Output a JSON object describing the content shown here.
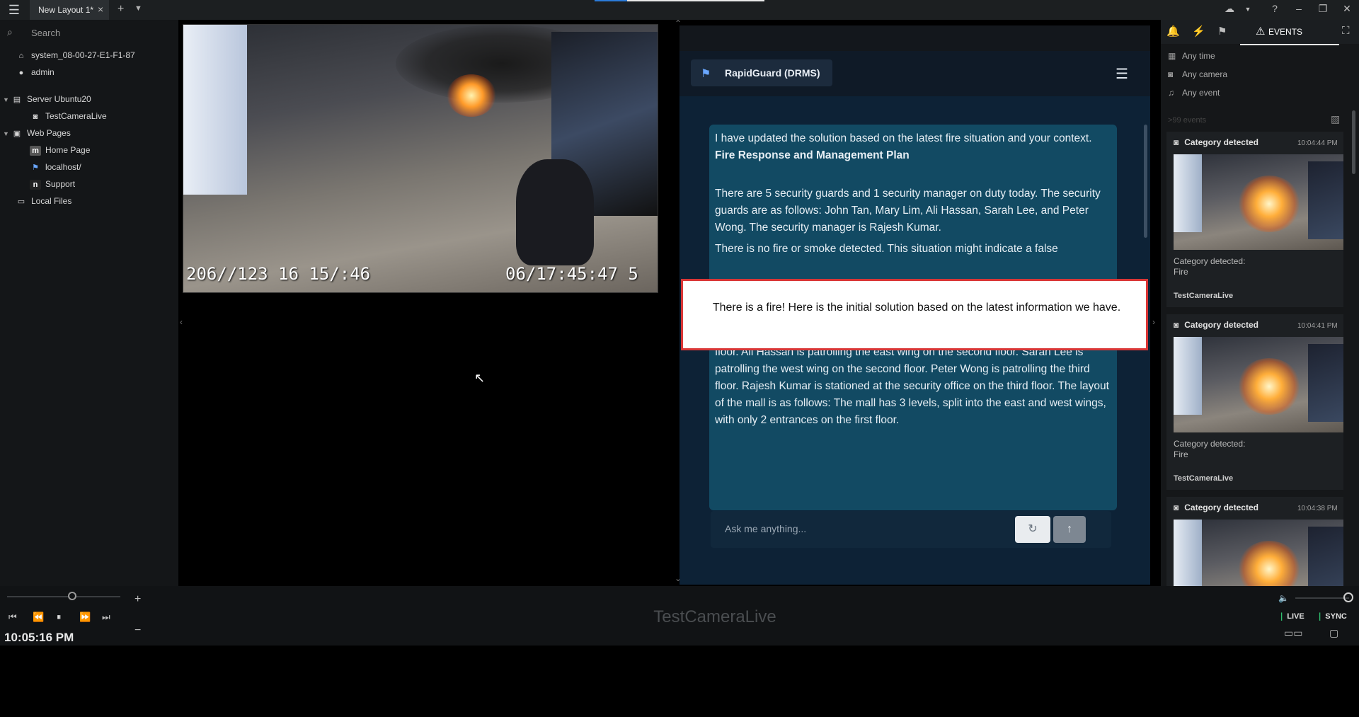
{
  "topbar": {
    "tab_label": "New Layout 1*",
    "tab_close": "×",
    "add_tab": "+",
    "tab_menu": "⌄",
    "icons": [
      "cloud-icon",
      "help-icon",
      "minimize-icon",
      "restore-icon",
      "close-icon"
    ]
  },
  "leftpanel": {
    "search_placeholder": "Search",
    "tree": {
      "system": "system_08-00-27-E1-F1-87",
      "user": "admin",
      "server": "Server Ubuntu20",
      "camera": "TestCameraLive",
      "web_pages": "Web Pages",
      "home_page": "Home Page",
      "localhost": "localhost/",
      "support": "Support",
      "local_files": "Local Files"
    }
  },
  "video": {
    "timestamp_left": "206//123 16 15/:46",
    "timestamp_right": "06/17:45:47 5"
  },
  "chat": {
    "brand": "RapidGuard (DRMS)",
    "intro": "I have updated the solution based on the latest fire situation and your context.",
    "heading": "Fire Response and Management Plan",
    "para1": "There are 5 security guards and 1 security manager on duty today. The security guards are as follows: John Tan, Mary Lim, Ali Hassan, Sarah Lee, and Peter Wong. The security manager is Rajesh Kumar.",
    "para2": "There is no fire or smoke detected. This situation might indicate a false",
    "para3": "trained in fire safety and evacuation procedures. John Tan is stationed at the east entrance on the first floor. Mary Lim is stationed at the west entrance on the first floor. Ali Hassan is patrolling the east wing on the second floor. Sarah Lee is patrolling the west wing on the second floor. Peter Wong is patrolling the third floor. Rajesh Kumar is stationed at the security office on the third floor. The layout of the mall is as follows: The mall has 3 levels, split into the east and west wings, with only 2 entrances on the first floor.",
    "input_placeholder": "Ask me anything..."
  },
  "alert": {
    "text": "There is a fire! Here is the initial solution based on the latest information we have."
  },
  "rightpanel": {
    "events_tab": "EVENTS",
    "filters": [
      "Any time",
      "Any camera",
      "Any event"
    ],
    "event_count": ">99 events",
    "events": [
      {
        "title": "Category detected",
        "time": "10:04:44 PM",
        "line1": "Category detected:",
        "line2": "Fire",
        "camera": "TestCameraLive"
      },
      {
        "title": "Category detected",
        "time": "10:04:41 PM",
        "line1": "Category detected:",
        "line2": "Fire",
        "camera": "TestCameraLive"
      },
      {
        "title": "Category detected",
        "time": "10:04:38 PM"
      }
    ]
  },
  "bottombar": {
    "clock": "10:05:16 PM",
    "camera_name": "TestCameraLive",
    "live_label": "LIVE",
    "sync_label": "SYNC",
    "zoom_in": "+",
    "zoom_out": "−"
  }
}
